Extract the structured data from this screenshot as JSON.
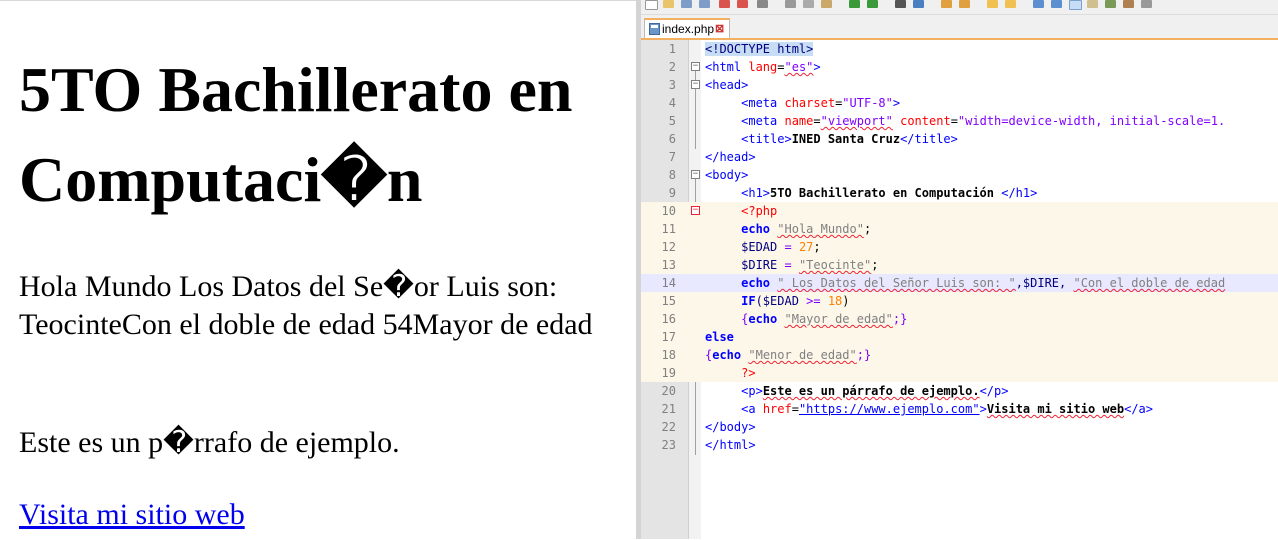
{
  "browser": {
    "heading": "5TO Bachillerato en Computaci�n",
    "output_paragraph": "Hola Mundo Los Datos del Se�or Luis son: TeocinteCon el doble de edad 54Mayor de edad",
    "paragraph": "Este es un p�rrafo de ejemplo.",
    "link": "Visita mi sitio web"
  },
  "editor": {
    "tab": {
      "label": "index.php",
      "close": "⊠"
    },
    "line_numbers": [
      "1",
      "2",
      "3",
      "4",
      "5",
      "6",
      "7",
      "8",
      "9",
      "10",
      "11",
      "12",
      "13",
      "14",
      "15",
      "16",
      "17",
      "18",
      "19",
      "20",
      "21",
      "22",
      "23"
    ],
    "code": {
      "l1_doctype": "<!DOCTYPE html>",
      "l2_html_lang": "<html",
      "l2_attr": "lang",
      "l2_val": "\"es\"",
      "l3": "<head>",
      "l4_tag": "<meta",
      "l4_attr": "charset",
      "l4_val": "\"UTF-8\"",
      "l5_tag": "<meta",
      "l5_attr1": "name",
      "l5_val1": "\"viewport\"",
      "l5_attr2": "content",
      "l5_val2": "\"width=device-width, initial-scale=1.",
      "l6_open": "<title>",
      "l6_text": "INED Santa Cruz",
      "l6_close": "</title>",
      "l7": "</head>",
      "l8": "<body>",
      "l9_open": "<h1>",
      "l9_text": "5TO Bachillerato en Computación ",
      "l9_close": "</h1>",
      "l10": "<?php",
      "l11_kw": "echo",
      "l11_str": "\"Hola Mundo\"",
      "l11_end": ";",
      "l12_var": "$EDAD",
      "l12_op": " = ",
      "l12_num": "27",
      "l12_end": ";",
      "l13_var": "$DIRE",
      "l13_op": " = ",
      "l13_str": "\"Teocinte\"",
      "l13_end": ";",
      "l14_kw": "echo",
      "l14_str1": "\" Los Datos del Señor Luis son: \"",
      "l14_mid": ",$DIRE, ",
      "l14_str2": "\"Con el doble de edad",
      "l15_kw": "IF",
      "l15_rest1": "($EDAD ",
      "l15_op": ">=",
      "l15_num": " 18",
      "l15_rest2": ")",
      "l16_open": "{",
      "l16_kw": "echo",
      "l16_str": "\"Mayor de edad\"",
      "l16_end": ";}",
      "l17": "else",
      "l18_open": "{",
      "l18_kw": "echo",
      "l18_str": "\"Menor de edad\"",
      "l18_end": ";}",
      "l19": "?>",
      "l20_open": "<p>",
      "l20_text": "Este es un párrafo de ejemplo.",
      "l20_close": "</p>",
      "l21_tag": "<a",
      "l21_attr": "href",
      "l21_val": "\"https://www.ejemplo.com\"",
      "l21_gt": ">",
      "l21_text": "Visita mi sitio web",
      "l21_close": "</a>",
      "l22": "</body>",
      "l23": "</html>"
    }
  }
}
